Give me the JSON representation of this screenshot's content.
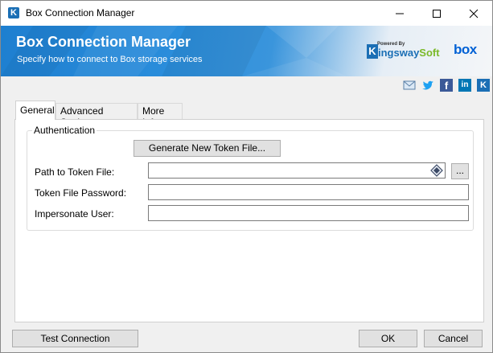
{
  "window": {
    "title": "Box Connection Manager",
    "app_icon_letter": "K"
  },
  "banner": {
    "title": "Box Connection Manager",
    "subtitle": "Specify how to connect to Box storage services",
    "powered_by": "Powered By",
    "brand_k": "K",
    "brand_name": "ingsway",
    "brand_soft": "Soft",
    "partner_logo": "box"
  },
  "social": {
    "facebook_glyph": "f",
    "linkedin_glyph": "in",
    "kingsway_glyph": "K"
  },
  "tabs": [
    {
      "label": "General",
      "active": true
    },
    {
      "label": "Advanced Settings",
      "active": false
    },
    {
      "label": "More Info",
      "active": false
    }
  ],
  "authentication": {
    "group_label": "Authentication",
    "generate_button": "Generate New Token File...",
    "path_label": "Path to Token File:",
    "path_value": "",
    "browse_button": "...",
    "password_label": "Token File Password:",
    "password_value": "",
    "impersonate_label": "Impersonate User:",
    "impersonate_value": ""
  },
  "footer": {
    "test_button": "Test Connection",
    "ok_button": "OK",
    "cancel_button": "Cancel"
  },
  "colors": {
    "brand_blue": "#1b6fb5",
    "brand_green": "#7ab929",
    "box_blue": "#0061d5"
  }
}
